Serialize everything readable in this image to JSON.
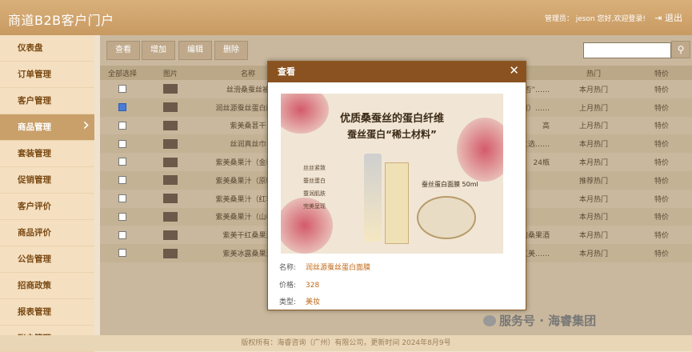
{
  "header": {
    "title": "商道B2B客户门户",
    "admin_label": "管理员：",
    "user": "jeson",
    "welcome": "您好,欢迎登录!",
    "logout": "退出"
  },
  "sidebar": {
    "items": [
      {
        "label": "仪表盘"
      },
      {
        "label": "订单管理"
      },
      {
        "label": "客户管理"
      },
      {
        "label": "商品管理"
      },
      {
        "label": "套装管理"
      },
      {
        "label": "促销管理"
      },
      {
        "label": "客户评价"
      },
      {
        "label": "商品评价"
      },
      {
        "label": "公告管理"
      },
      {
        "label": "招商政策"
      },
      {
        "label": "报表管理"
      },
      {
        "label": "账户管理"
      }
    ]
  },
  "toolbar": {
    "view": "查看",
    "add": "增加",
    "edit": "编辑",
    "delete": "删除",
    "search_placeholder": ""
  },
  "table": {
    "headers": {
      "select_all": "全部选择",
      "image": "图片",
      "name": "名称",
      "hot": "热门",
      "special": "特价"
    },
    "rows": [
      {
        "checked": false,
        "name": "丝滑桑蚕丝被",
        "desc": "还有“否”……",
        "hot": "本月热门",
        "special": "特价"
      },
      {
        "checked": true,
        "name": "润丝源蚕丝蛋白面膜",
        "desc": "你好好面膜）……",
        "hot": "上月热门",
        "special": "特价"
      },
      {
        "checked": false,
        "name": "紫美桑葚干",
        "desc": "高",
        "hot": "上月热门",
        "special": "特价"
      },
      {
        "checked": false,
        "name": "丝润真丝巾",
        "desc": "感的明眸之选……",
        "hot": "本月热门",
        "special": "特价"
      },
      {
        "checked": false,
        "name": "紫美桑果汁（金装）",
        "desc": "24瓶",
        "hot": "本月热门",
        "special": "特价"
      },
      {
        "checked": false,
        "name": "紫美桑果汁（原味）",
        "desc": "",
        "hot": "推荐热门",
        "special": "特价"
      },
      {
        "checked": false,
        "name": "紫美桑果汁（红李）",
        "desc": "",
        "hot": "本月热门",
        "special": "特价"
      },
      {
        "checked": false,
        "name": "紫美桑果汁（山楂）",
        "desc": "",
        "hot": "本月热门",
        "special": "特价"
      },
      {
        "checked": false,
        "name": "紫美干红桑果酒",
        "desc": "采的桑果酒",
        "hot": "本月热门",
        "special": "特价"
      },
      {
        "checked": false,
        "name": "紫美冰露桑果酒",
        "desc": "坏，健康又美……",
        "hot": "本月热门",
        "special": "特价"
      }
    ]
  },
  "modal": {
    "title": "查看",
    "poster": {
      "headline": "优质桑蚕丝的蛋白纤维",
      "headline2": "蚕丝蛋白“稀土材料”",
      "features": [
        "丝丝紧致",
        "蚕丝蛋白",
        "蚕润肌肤",
        "完美呈现"
      ],
      "product_label": "蚕丝蛋白面膜 50ml"
    },
    "name_label": "名称:",
    "name_value": "润丝源蚕丝蛋白面膜",
    "price_label": "价格:",
    "price_value": "328",
    "type_label": "类型:",
    "type_value": "美妆"
  },
  "footer": {
    "text": "版权所有：海睿咨询（广州）有限公司，更新时间 2024年8月9号"
  },
  "watermark": {
    "text": "服务号 · 海睿集团"
  }
}
